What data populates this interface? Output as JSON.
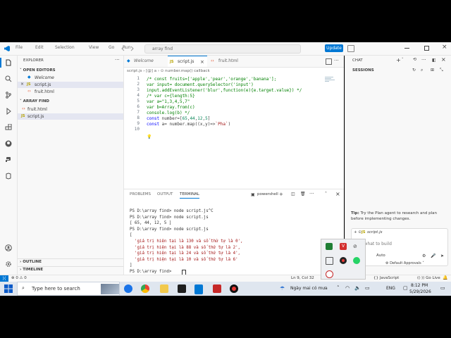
{
  "titlebar": {
    "menus": [
      "File",
      "Edit",
      "Selection",
      "View",
      "Go",
      "Run"
    ],
    "search_text": "array find",
    "update_label": "Update"
  },
  "sidebar": {
    "title": "EXPLORER",
    "open_editors_label": "OPEN EDITORS",
    "open_editors": [
      "Welcome",
      "script.js",
      "fruit.html"
    ],
    "folder_label": "ARRAY FIND",
    "files": [
      "fruit.html",
      "script.js"
    ],
    "outline_label": "OUTLINE",
    "timeline_label": "TIMELINE"
  },
  "editor": {
    "tabs": [
      "Welcome",
      "script.js",
      "fruit.html"
    ],
    "breadcrumb": {
      "file": "script.js",
      "symbol": "a",
      "callback": "number.map() callback"
    },
    "lines": [
      "/* const fruits=['apple','pear','orange','banana'];",
      "var input= document.querySelector('input')",
      "input.addEventListener('blur',function(e){e.target.value}) */",
      "/* var c={length:5}",
      "var a=\"1,3,4,5,7\"",
      "var b=Array.from(c)",
      "console.log(b) */",
      "const number=[65,44,12,5]",
      "const a= number.map((x,y)=>`Pha`)",
      ""
    ],
    "line_numbers": [
      "1",
      "2",
      "3",
      "4",
      "5",
      "6",
      "7",
      "8",
      "9",
      "10"
    ]
  },
  "panel": {
    "tabs": [
      "PROBLEMS",
      "OUTPUT",
      "TERMINAL"
    ],
    "shell_label": "powershell",
    "lines": [
      "PS D:\\array find> node script.js^C",
      "PS D:\\array find> node script.js",
      "[ 65, 44, 12, 5 ]",
      "PS D:\\array find> node script.js",
      "[",
      "  'giá trị hiện tại là 130 và số thứ tự là 0',",
      "  'giá trị hiện tại là 88 và số thứ tự là 2',",
      "  'giá trị hiện tại là 24 và số thứ tự là 4',",
      "  'giá trị hiện tại là 10 và số thứ tự là 6'",
      "]",
      "PS D:\\array find> "
    ]
  },
  "chat": {
    "title": "CHAT",
    "sessions_label": "SESSIONS",
    "tip_bold": "Tip:",
    "tip_text": "Try the Plan agent to research and plan before implementing changes.",
    "context_file": "script.js",
    "input_placeholder": "ribe what to build",
    "auto_label": "Auto",
    "approvals_label": "Default Approvals"
  },
  "statusbar": {
    "errors": "0",
    "warnings": "0",
    "position": "Ln 9, Col 32",
    "language": "JavaScript",
    "golive": "Go Live"
  },
  "taskbar": {
    "search_placeholder": "Type here to search",
    "weather": "Ngày mai có mưa",
    "language": "ENG",
    "time": "8:12 PM",
    "date": "5/29/2026"
  },
  "colors": {
    "accent": "#0078d4",
    "keyword": "#0000ff",
    "comment": "#008000",
    "string": "#a31515",
    "number": "#098658"
  }
}
